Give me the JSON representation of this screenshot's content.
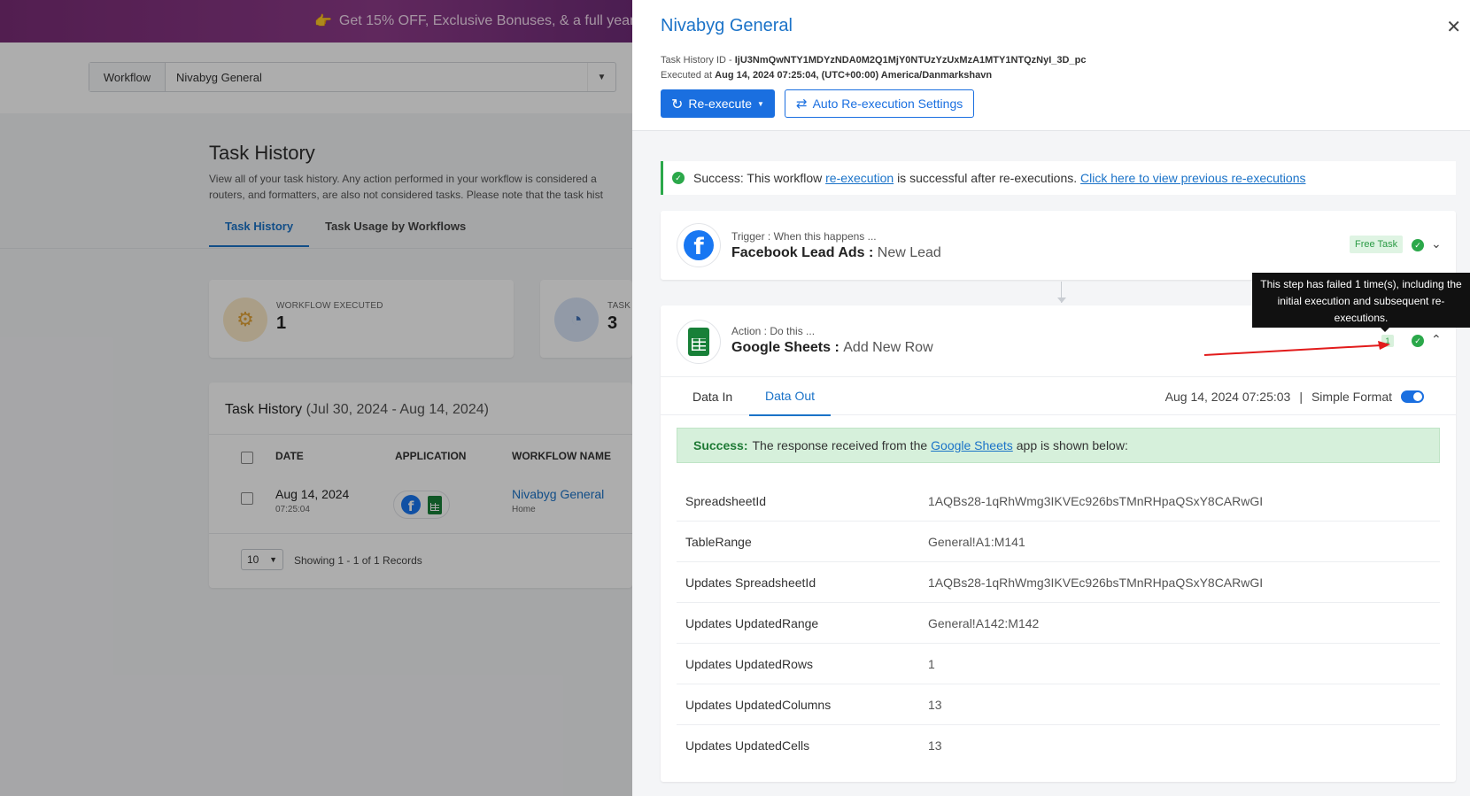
{
  "promo": {
    "text": "Get 15% OFF, Exclusive Bonuses, & a full year"
  },
  "workflow_select": {
    "label": "Workflow",
    "value": "Nivabyg General"
  },
  "bg_page": {
    "title": "Task History",
    "description_line1": "View all of your task history. Any action performed in your workflow is considered a",
    "description_line2": "routers, and formatters, are also not considered tasks. Please note that the task hist",
    "tabs": [
      "Task History",
      "Task Usage by Workflows"
    ],
    "stats": [
      {
        "label": "WORKFLOW EXECUTED",
        "value": "1"
      },
      {
        "label": "TASK",
        "value": "3"
      }
    ],
    "history": {
      "title": "Task History",
      "range": "(Jul 30, 2024 - Aug 14, 2024)",
      "columns": [
        "DATE",
        "APPLICATION",
        "WORKFLOW NAME"
      ],
      "row": {
        "date": "Aug 14, 2024",
        "time": "07:25:04",
        "workflow": "Nivabyg General",
        "folder": "Home"
      },
      "page_size": "10",
      "showing": "Showing 1 - 1 of 1 Records"
    }
  },
  "drawer": {
    "title": "Nivabyg General",
    "task_id_label": "Task History ID -",
    "task_id": "IjU3NmQwNTY1MDYzNDA0M2Q1MjY0NTUzYzUxMzA1MTY1NTQzNyI_3D_pc",
    "executed_label": "Executed at",
    "executed_at": "Aug 14, 2024 07:25:04, (UTC+00:00) America/Danmarkshavn",
    "reexecute_label": "Re-execute",
    "auto_reexec_label": "Auto Re-execution Settings",
    "success": {
      "prefix": "Success: This workflow",
      "link1": "re-execution",
      "middle": "is successful after re-executions.",
      "link2": "Click here to view previous re-executions"
    },
    "trigger": {
      "sub": "Trigger : When this happens ...",
      "app": "Facebook Lead Ads :",
      "event": "New Lead",
      "badge": "Free Task"
    },
    "action": {
      "sub": "Action : Do this ...",
      "app": "Google Sheets :",
      "event": "Add New Row",
      "fail_count": "1"
    },
    "tooltip": "This step has failed 1 time(s), including the initial execution and subsequent re-executions.",
    "tabs": [
      "Data In",
      "Data Out"
    ],
    "timestamp": "Aug 14, 2024 07:25:03",
    "separator": "|",
    "simple_format": "Simple Format",
    "response": {
      "bold": "Success:",
      "pre": "The response received from the",
      "link": "Google Sheets",
      "post": "app is shown below:"
    },
    "rows": [
      {
        "key": "SpreadsheetId",
        "value": "1AQBs28-1qRhWmg3IKVEc926bsTMnRHpaQSxY8CARwGI"
      },
      {
        "key": "TableRange",
        "value": "General!A1:M141"
      },
      {
        "key": "Updates SpreadsheetId",
        "value": "1AQBs28-1qRhWmg3IKVEc926bsTMnRHpaQSxY8CARwGI"
      },
      {
        "key": "Updates UpdatedRange",
        "value": "General!A142:M142"
      },
      {
        "key": "Updates UpdatedRows",
        "value": "1"
      },
      {
        "key": "Updates UpdatedColumns",
        "value": "13"
      },
      {
        "key": "Updates UpdatedCells",
        "value": "13"
      }
    ]
  },
  "colors": {
    "primary": "#1a6fe0",
    "success": "#2ba84a",
    "facebook": "#1877f2",
    "sheets": "#188038",
    "annotation_arrow": "#e21b1b"
  }
}
